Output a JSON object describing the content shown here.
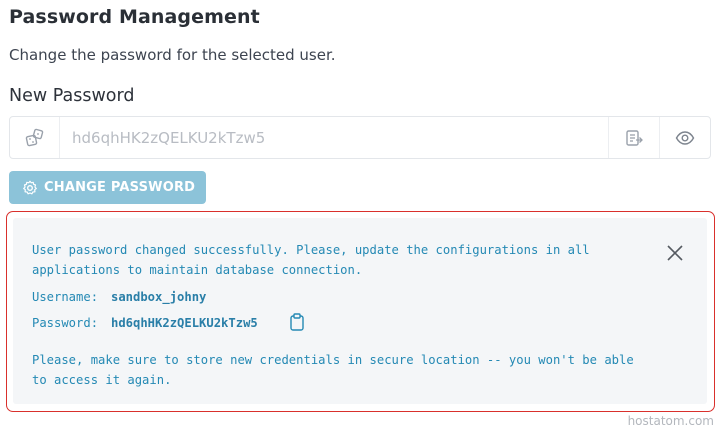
{
  "page": {
    "title": "Password Management",
    "description": "Change the password for the selected user."
  },
  "new_password": {
    "label": "New Password",
    "placeholder": "hd6qhHK2zQELKU2kTzw5",
    "icons": [
      "dice-icon",
      "clipboard-copy-icon",
      "eye-icon"
    ]
  },
  "change_button": {
    "label": "CHANGE PASSWORD",
    "icon": "gear-icon",
    "color": "#8cc3d9"
  },
  "alert": {
    "message": "User password changed successfully. Please, update the configurations in all applications to maintain database connection.",
    "username_label": "Username:",
    "username_value": "sandbox_johny",
    "password_label": "Password:",
    "password_value": "hd6qhHK2zQELKU2kTzw5",
    "warning": "Please, make sure to store new credentials in secure location -- you won't be able to access it again.",
    "border_color": "#d9302c",
    "text_color": "#2489b4"
  },
  "watermark": "hostatom.com"
}
